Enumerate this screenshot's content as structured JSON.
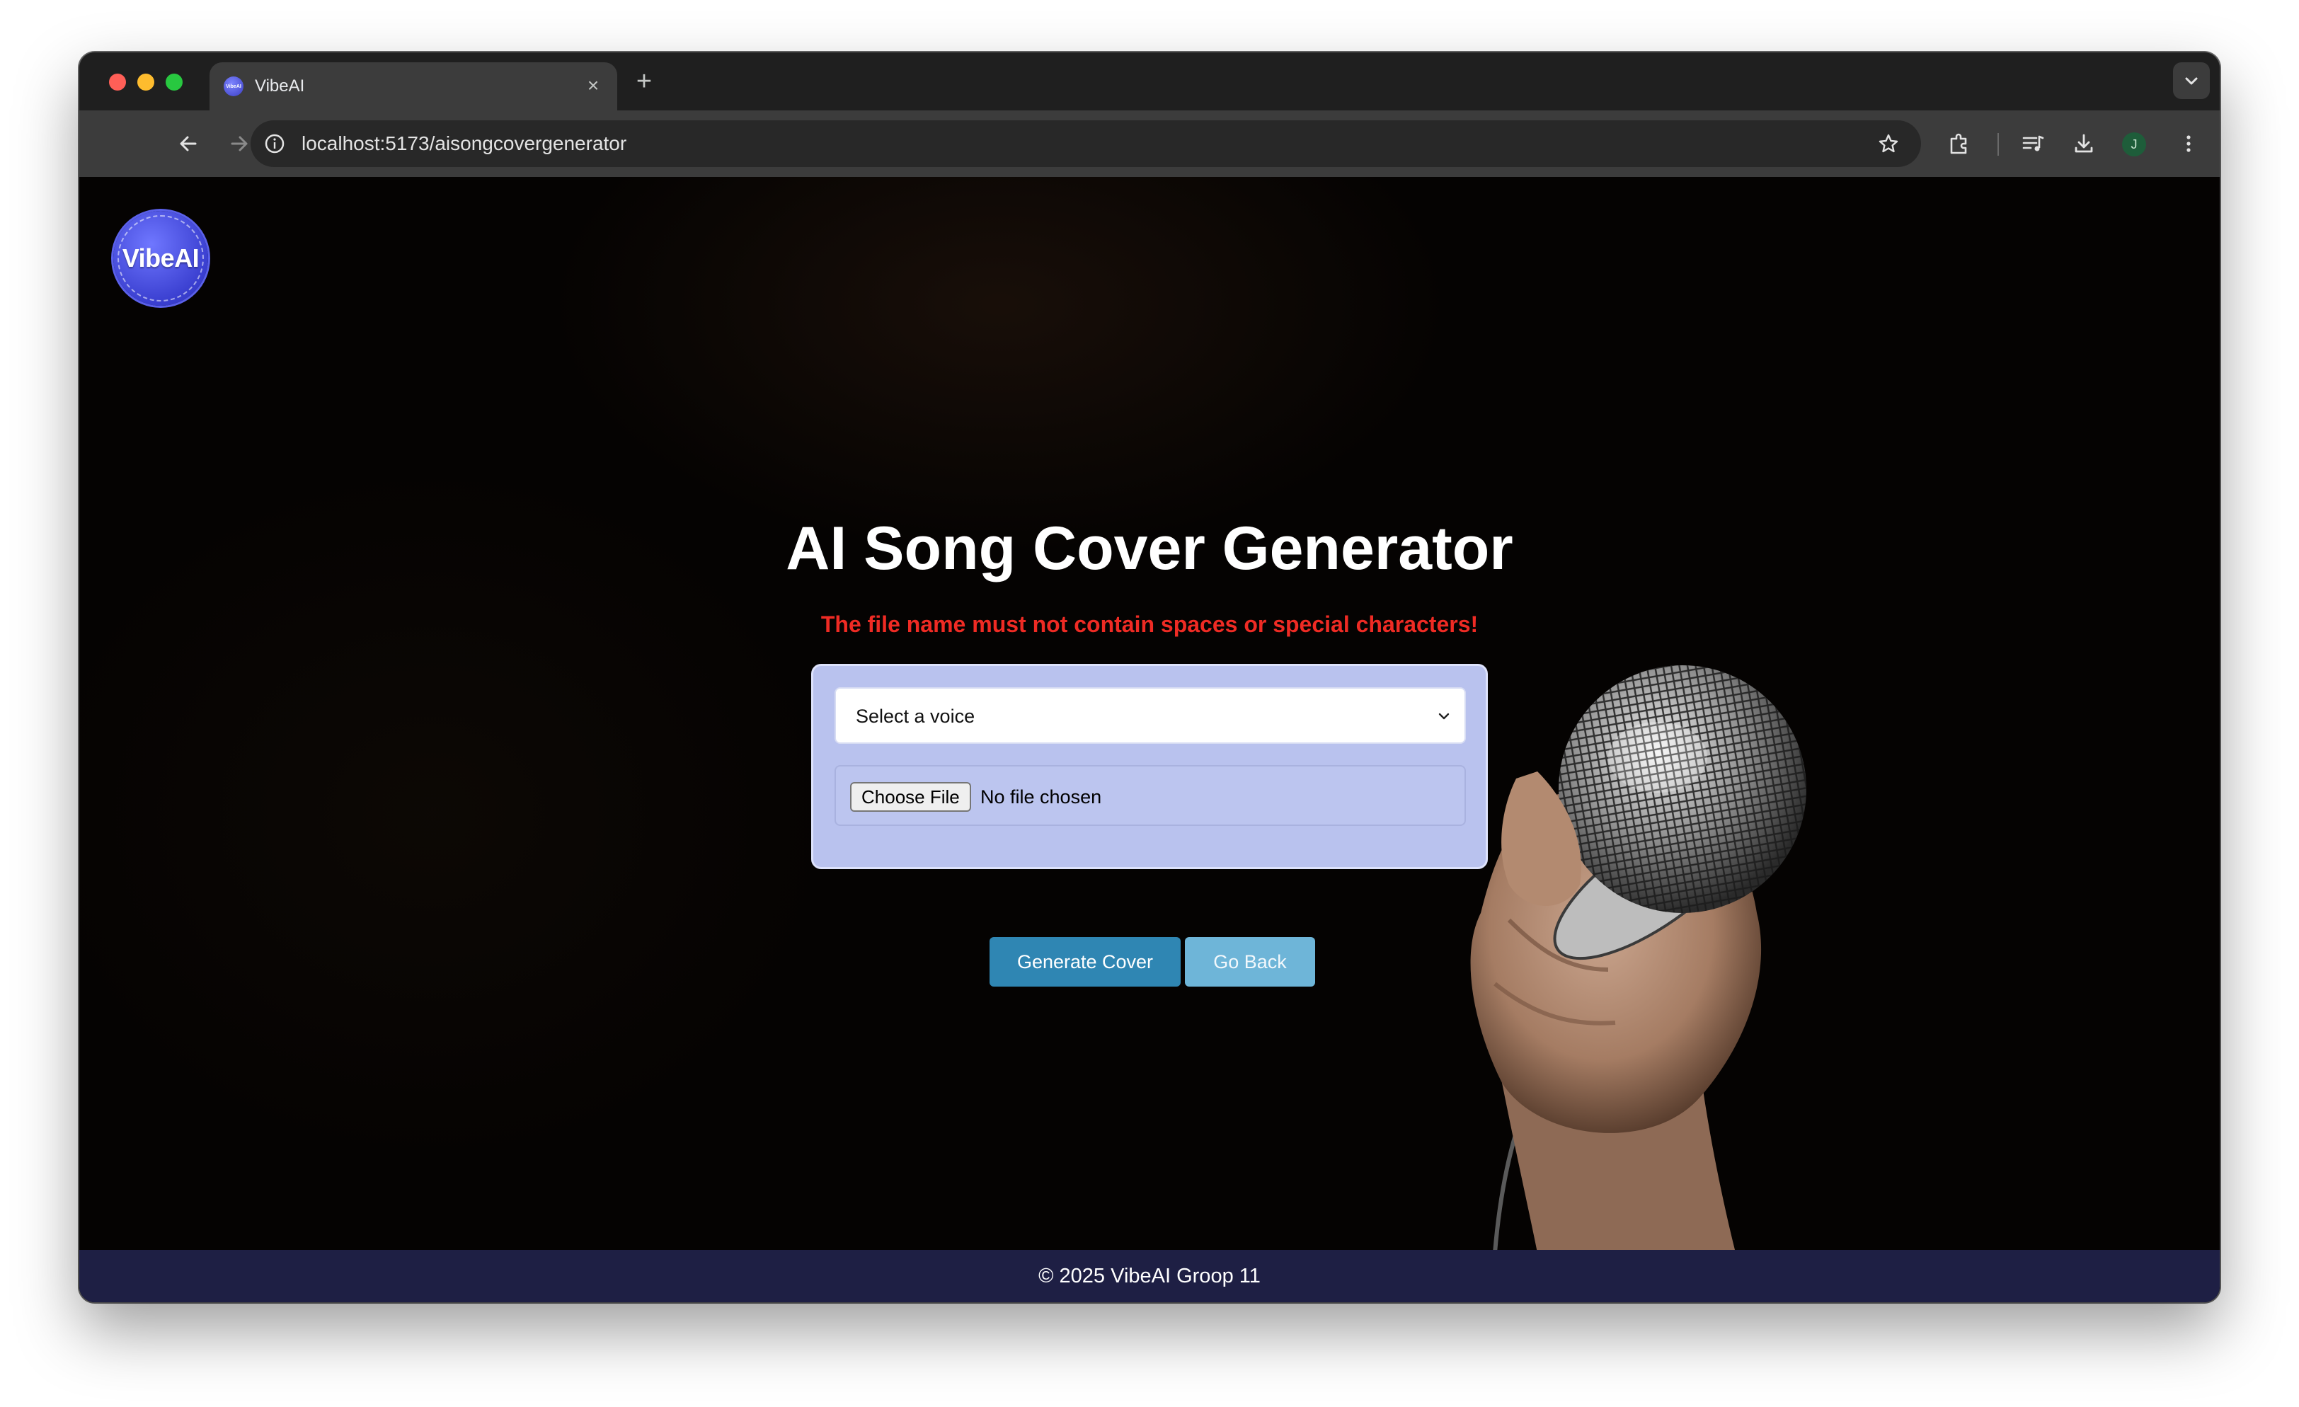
{
  "browser": {
    "tab": {
      "title": "VibeAI",
      "favicon_text": "VibeAI"
    },
    "address_bar": {
      "url": "localhost:5173/aisongcovergenerator"
    },
    "profile_initial": "J",
    "icons": [
      "back-icon",
      "forward-icon",
      "reload-icon",
      "info-icon",
      "star-icon",
      "extensions-icon",
      "media-icon",
      "download-icon",
      "more-icon"
    ]
  },
  "page": {
    "logo_text": "VibeAI",
    "title": "AI Song Cover Generator",
    "warning": "The file name must not contain spaces or special characters!",
    "form": {
      "voice_select": {
        "selected": "Select a voice"
      },
      "file_input": {
        "button_label": "Choose File",
        "status": "No file chosen"
      }
    },
    "buttons": {
      "generate": "Generate Cover",
      "back": "Go Back"
    },
    "footer": "© 2025 VibeAI Groop 11"
  },
  "colors": {
    "warning": "#ef2b24",
    "card": "#b9c2ee",
    "generate_button": "#2f86b3",
    "back_button": "#6eb5d8",
    "footer_bg": "#1e1f44",
    "logo": "#4a50e0"
  }
}
